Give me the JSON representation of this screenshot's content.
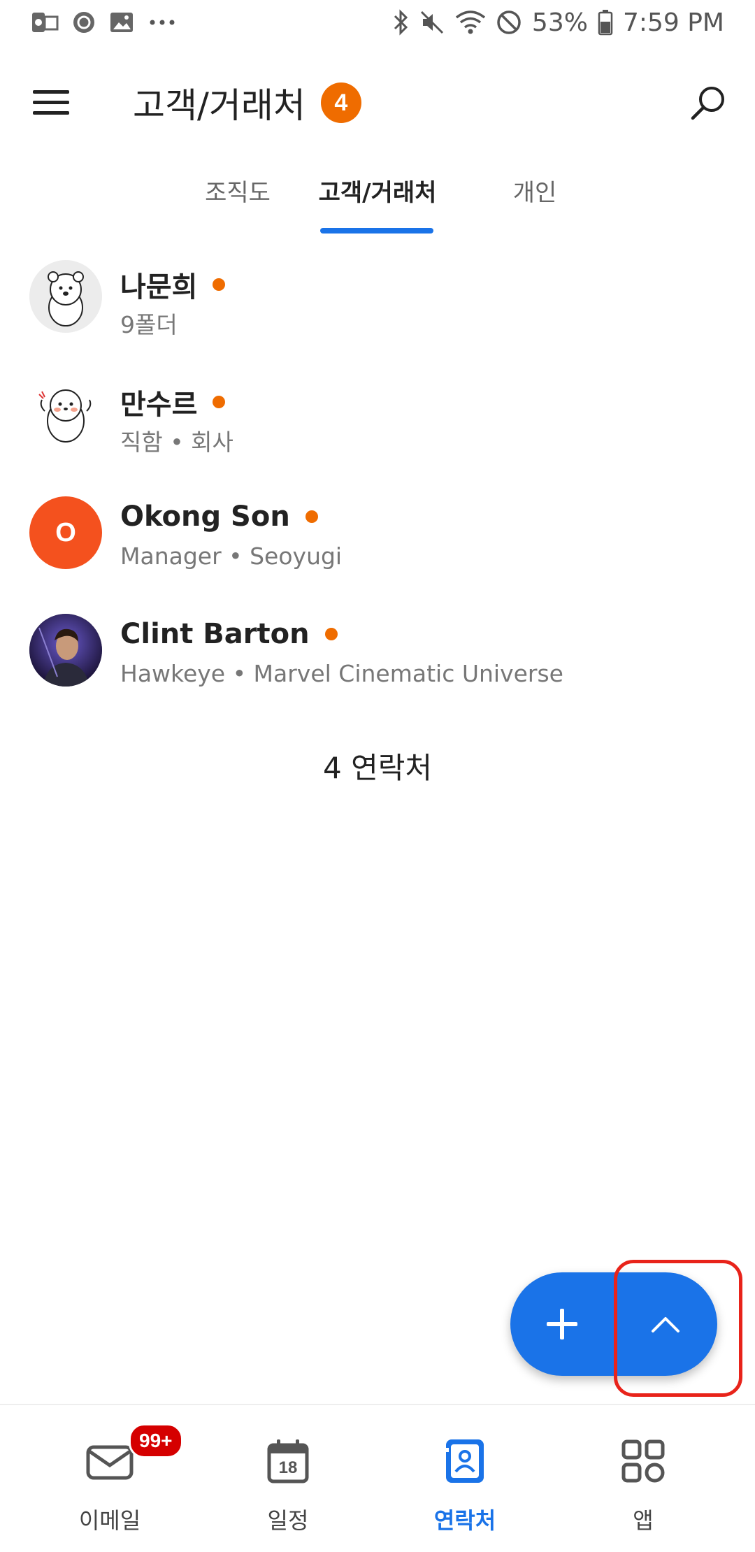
{
  "status_bar": {
    "battery": "53%",
    "time": "7:59 PM",
    "icons_left": [
      "outlook-icon",
      "sync-icon",
      "image-icon",
      "more-icon"
    ],
    "icons_right": [
      "bluetooth-icon",
      "mute-icon",
      "wifi-icon",
      "dnd-icon",
      "battery-icon"
    ]
  },
  "header": {
    "title": "고객/거래처",
    "badge": "4"
  },
  "tabs": [
    {
      "label": "조직도",
      "active": false
    },
    {
      "label": "고객/거래처",
      "active": true
    },
    {
      "label": "개인",
      "active": false
    }
  ],
  "contacts": [
    {
      "name": "나문희",
      "subtitle": "9폴더",
      "avatar": "bear-sticker"
    },
    {
      "name": "만수르",
      "subtitle": "직함 • 회사",
      "avatar": "seal-sticker"
    },
    {
      "name": "Okong Son",
      "subtitle": "Manager • Seoyugi",
      "avatar_initial": "O",
      "avatar_color": "#f4511e"
    },
    {
      "name": "Clint Barton",
      "subtitle": "Hawkeye • Marvel Cinematic Universe",
      "avatar": "photo"
    }
  ],
  "contact_count": "4 연락처",
  "bottom_nav": [
    {
      "label": "이메일",
      "badge": "99+",
      "icon": "mail-icon"
    },
    {
      "label": "일정",
      "icon": "calendar-icon",
      "calendar_day": "18"
    },
    {
      "label": "연락처",
      "icon": "contacts-icon",
      "active": true
    },
    {
      "label": "앱",
      "icon": "apps-grid-icon"
    }
  ],
  "colors": {
    "accent": "#1a73e8",
    "presence": "#ef6c00",
    "badge": "#d50000",
    "highlight": "#e8231a"
  }
}
